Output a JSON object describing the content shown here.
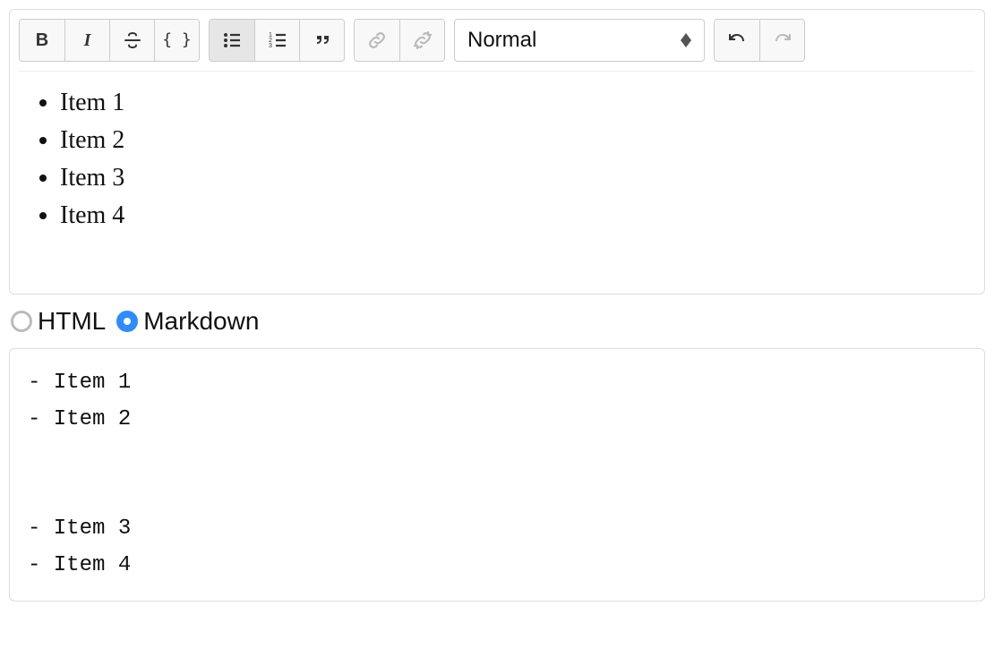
{
  "toolbar": {
    "heading_select": "Normal",
    "bold_glyph": "B",
    "code_glyph": "{ }"
  },
  "editor": {
    "items": [
      "Item 1",
      "Item 2",
      "Item 3",
      "Item 4"
    ]
  },
  "format_switch": {
    "options": {
      "html": "HTML",
      "markdown": "Markdown"
    },
    "selected": "markdown"
  },
  "output": "- Item 1\n- Item 2\n\n\n- Item 3\n- Item 4"
}
